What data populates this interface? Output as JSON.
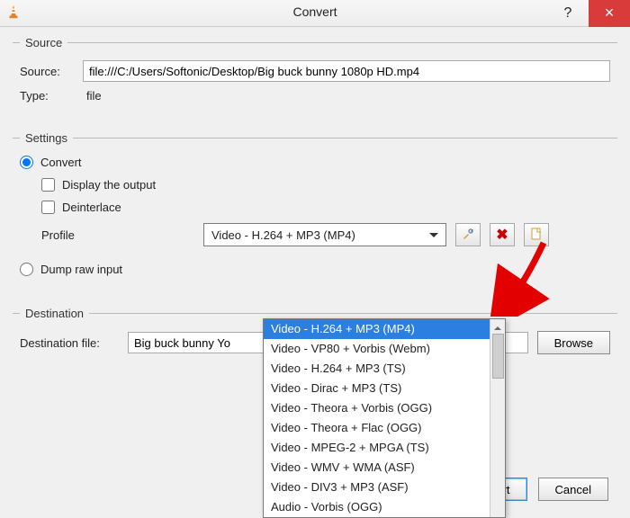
{
  "window": {
    "title": "Convert"
  },
  "source": {
    "legend": "Source",
    "label": "Source:",
    "value": "file:///C:/Users/Softonic/Desktop/Big buck bunny 1080p HD.mp4",
    "type_label": "Type:",
    "type_value": "file"
  },
  "settings": {
    "legend": "Settings",
    "convert_label": "Convert",
    "display_output_label": "Display the output",
    "deinterlace_label": "Deinterlace",
    "profile_label": "Profile",
    "profile_selected": "Video - H.264 + MP3 (MP4)",
    "profile_options": [
      "Video - H.264 + MP3 (MP4)",
      "Video - VP80 + Vorbis (Webm)",
      "Video - H.264 + MP3 (TS)",
      "Video - Dirac + MP3 (TS)",
      "Video - Theora + Vorbis (OGG)",
      "Video - Theora + Flac (OGG)",
      "Video - MPEG-2 + MPGA (TS)",
      "Video - WMV + WMA (ASF)",
      "Video - DIV3 + MP3 (ASF)",
      "Audio - Vorbis (OGG)"
    ],
    "dump_raw_label": "Dump raw input"
  },
  "destination": {
    "legend": "Destination",
    "label": "Destination file:",
    "value": "Big buck bunny Yo",
    "browse_label": "Browse"
  },
  "footer": {
    "start": "Start",
    "cancel": "Cancel"
  }
}
